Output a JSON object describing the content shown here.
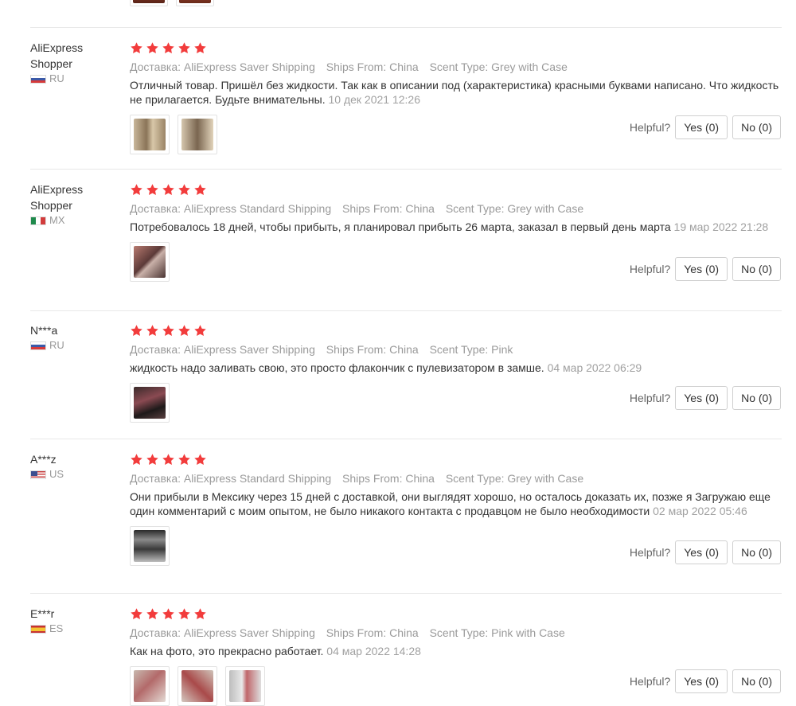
{
  "helpful_label": "Helpful?",
  "star_color": "#f23c3c",
  "reviews": [
    {
      "user": "AliExpress Shopper",
      "country": "RU",
      "rating": 5,
      "delivery": "Доставка: AliExpress Saver Shipping",
      "ships_from": "Ships From: China",
      "scent": "Scent Type: Grey with Case",
      "text": "Отличный товар. Пришёл без жидкости. Так как в описании под (характеристика) красными буквами написано. Что жидкость не прилагается. Будьте внимательны.",
      "date": "10 дек 2021 12:26",
      "photos": 2,
      "yes": "Yes (0)",
      "no": "No (0)"
    },
    {
      "user": "AliExpress Shopper",
      "country": "MX",
      "rating": 5,
      "delivery": "Доставка: AliExpress Standard Shipping",
      "ships_from": "Ships From: China",
      "scent": "Scent Type: Grey with Case",
      "text": "Потребовалось 18 дней, чтобы прибыть, я планировал прибыть 26 марта, заказал в первый день марта",
      "date": "19 мар 2022 21:28",
      "photos": 1,
      "yes": "Yes (0)",
      "no": "No (0)"
    },
    {
      "user": "N***a",
      "country": "RU",
      "rating": 5,
      "delivery": "Доставка: AliExpress Saver Shipping",
      "ships_from": "Ships From: China",
      "scent": "Scent Type: Pink",
      "text": "жидкость надо заливать свою, это просто флакончик с пулевизатором в замше.",
      "date": "04 мар 2022 06:29",
      "photos": 1,
      "yes": "Yes (0)",
      "no": "No (0)"
    },
    {
      "user": "A***z",
      "country": "US",
      "rating": 5,
      "delivery": "Доставка: AliExpress Standard Shipping",
      "ships_from": "Ships From: China",
      "scent": "Scent Type: Grey with Case",
      "text": "Они прибыли в Мексику через 15 дней с доставкой, они выглядят хорошо, но осталось доказать их, позже я Загружаю еще один комментарий с моим опытом, не было никакого контакта с продавцом не было необходимости",
      "date": "02 мар 2022 05:46",
      "photos": 1,
      "yes": "Yes (0)",
      "no": "No (0)"
    },
    {
      "user": "E***r",
      "country": "ES",
      "rating": 5,
      "delivery": "Доставка: AliExpress Saver Shipping",
      "ships_from": "Ships From: China",
      "scent": "Scent Type: Pink with Case",
      "text": "Как на фото, это прекрасно работает.",
      "date": "04 мар 2022 14:28",
      "photos": 3,
      "yes": "Yes (0)",
      "no": "No (0)"
    }
  ]
}
